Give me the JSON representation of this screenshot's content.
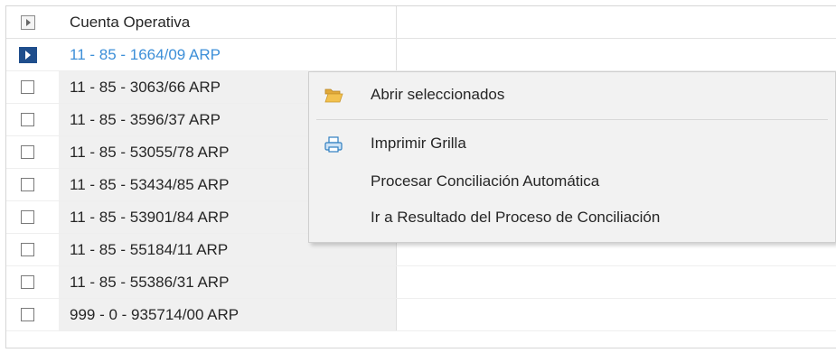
{
  "grid": {
    "column_header": "Cuenta Operativa",
    "rows": [
      {
        "label": "11 - 85 - 1664/09 ARP",
        "active": true
      },
      {
        "label": "11 - 85 - 3063/66 ARP"
      },
      {
        "label": "11 - 85 - 3596/37 ARP"
      },
      {
        "label": "11 - 85 - 53055/78 ARP"
      },
      {
        "label": "11 - 85 - 53434/85 ARP"
      },
      {
        "label": "11 - 85 - 53901/84 ARP"
      },
      {
        "label": "11 - 85 - 55184/11 ARP"
      },
      {
        "label": "11 - 85 - 55386/31 ARP"
      },
      {
        "label": "999 - 0 - 935714/00 ARP"
      }
    ]
  },
  "context_menu": {
    "items": [
      {
        "label": "Abrir seleccionados",
        "icon": "folder-open-icon"
      },
      {
        "label": "Imprimir Grilla",
        "icon": "printer-icon"
      },
      {
        "label": "Procesar Conciliación Automática"
      },
      {
        "label": "Ir a Resultado del Proceso de Conciliación"
      }
    ]
  },
  "colors": {
    "active_row_text": "#3d8fd8",
    "row_pointer": "#1f4e8c",
    "folder_icon": "#f2c14e"
  }
}
